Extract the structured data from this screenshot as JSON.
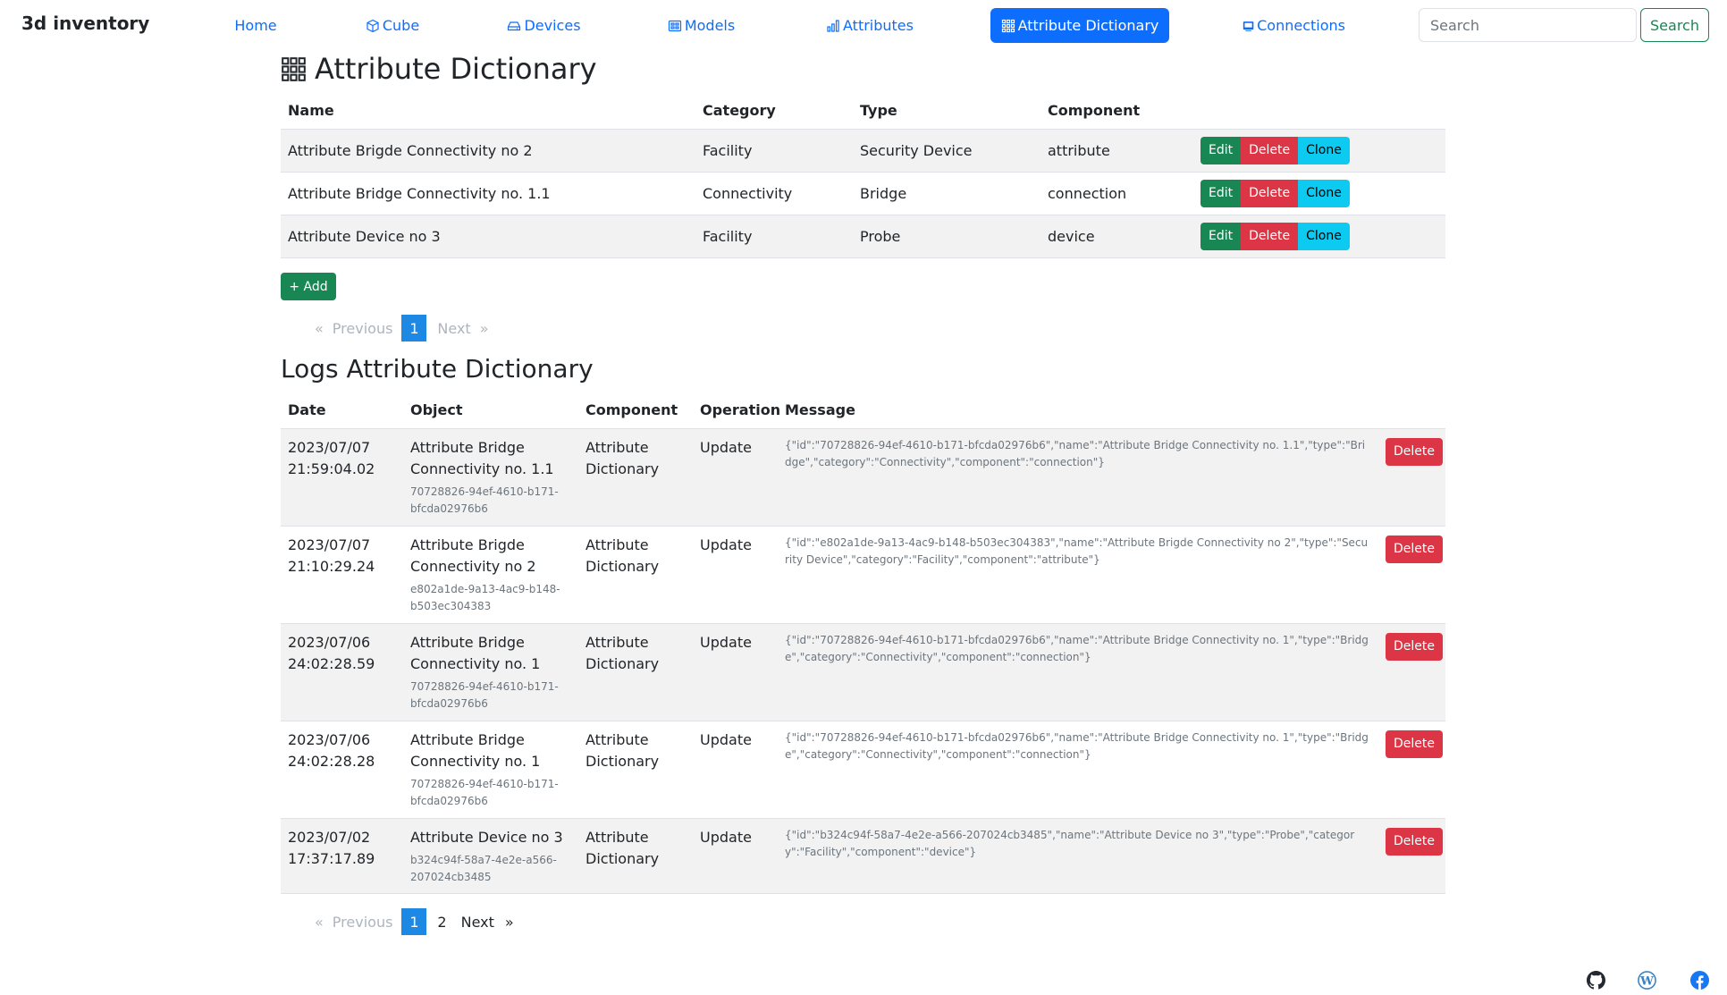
{
  "brand": "3d inventory",
  "nav": {
    "home": "Home",
    "cube": "Cube",
    "devices": "Devices",
    "models": "Models",
    "attributes": "Attributes",
    "attribute_dictionary": "Attribute Dictionary",
    "connections": "Connections"
  },
  "search": {
    "placeholder": "Search",
    "button": "Search"
  },
  "colors": {
    "primary": "#0d6efd",
    "success": "#198754",
    "danger": "#dc3545",
    "info": "#0dcaf0"
  },
  "page_title": "Attribute Dictionary",
  "dictionary": {
    "headers": {
      "name": "Name",
      "category": "Category",
      "type": "Type",
      "component": "Component"
    },
    "rows": [
      {
        "name": "Attribute Brigde Connectivity no 2",
        "category": "Facility",
        "type": "Security Device",
        "component": "attribute"
      },
      {
        "name": "Attribute Bridge Connectivity no. 1.1",
        "category": "Connectivity",
        "type": "Bridge",
        "component": "connection"
      },
      {
        "name": "Attribute Device no 3",
        "category": "Facility",
        "type": "Probe",
        "component": "device"
      }
    ],
    "actions": {
      "edit": "Edit",
      "delete": "Delete",
      "clone": "Clone"
    },
    "add_label": "+ Add",
    "pagination": {
      "previous": "Previous",
      "next": "Next",
      "pages": [
        "1"
      ],
      "active": "1",
      "prev_arrow": "«",
      "next_arrow": "»"
    }
  },
  "logs_title": "Logs Attribute Dictionary",
  "logs": {
    "headers": {
      "date": "Date",
      "object": "Object",
      "component": "Component",
      "operation": "Operation",
      "message": "Message"
    },
    "delete_label": "Delete",
    "rows": [
      {
        "date": "2023/07/07",
        "time": "21:59:04.02",
        "object": "Attribute Bridge Connectivity no. 1.1",
        "object_id": "70728826-94ef-4610-b171-bfcda02976b6",
        "component": "Attribute Dictionary",
        "operation": "Update",
        "message": "{\"id\":\"70728826-94ef-4610-b171-bfcda02976b6\",\"name\":\"Attribute Bridge Connectivity no. 1.1\",\"type\":\"Bridge\",\"category\":\"Connectivity\",\"component\":\"connection\"}"
      },
      {
        "date": "2023/07/07",
        "time": "21:10:29.24",
        "object": "Attribute Brigde Connectivity no 2",
        "object_id": "e802a1de-9a13-4ac9-b148-b503ec304383",
        "component": "Attribute Dictionary",
        "operation": "Update",
        "message": "{\"id\":\"e802a1de-9a13-4ac9-b148-b503ec304383\",\"name\":\"Attribute Brigde Connectivity no 2\",\"type\":\"Security Device\",\"category\":\"Facility\",\"component\":\"attribute\"}"
      },
      {
        "date": "2023/07/06",
        "time": "24:02:28.59",
        "object": "Attribute Bridge Connectivity no. 1",
        "object_id": "70728826-94ef-4610-b171-bfcda02976b6",
        "component": "Attribute Dictionary",
        "operation": "Update",
        "message": "{\"id\":\"70728826-94ef-4610-b171-bfcda02976b6\",\"name\":\"Attribute Bridge Connectivity no. 1\",\"type\":\"Bridge\",\"category\":\"Connectivity\",\"component\":\"connection\"}"
      },
      {
        "date": "2023/07/06",
        "time": "24:02:28.28",
        "object": "Attribute Bridge Connectivity no. 1",
        "object_id": "70728826-94ef-4610-b171-bfcda02976b6",
        "component": "Attribute Dictionary",
        "operation": "Update",
        "message": "{\"id\":\"70728826-94ef-4610-b171-bfcda02976b6\",\"name\":\"Attribute Bridge Connectivity no. 1\",\"type\":\"Bridge\",\"category\":\"Connectivity\",\"component\":\"connection\"}"
      },
      {
        "date": "2023/07/02",
        "time": "17:37:17.89",
        "object": "Attribute Device no 3",
        "object_id": "b324c94f-58a7-4e2e-a566-207024cb3485",
        "component": "Attribute Dictionary",
        "operation": "Update",
        "message": "{\"id\":\"b324c94f-58a7-4e2e-a566-207024cb3485\",\"name\":\"Attribute Device no 3\",\"type\":\"Probe\",\"category\":\"Facility\",\"component\":\"device\"}"
      }
    ],
    "pagination": {
      "previous": "Previous",
      "next": "Next",
      "pages": [
        "1",
        "2"
      ],
      "active": "1",
      "prev_arrow": "«",
      "next_arrow": "»"
    }
  },
  "footer_icons": [
    "github-icon",
    "wordpress-icon",
    "facebook-icon"
  ]
}
